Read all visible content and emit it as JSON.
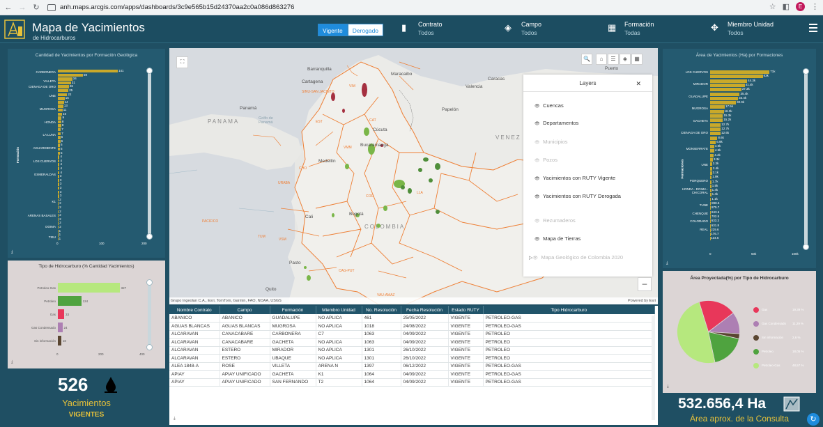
{
  "browser": {
    "url": "anh.maps.arcgis.com/apps/dashboards/3c9e565b15d24370aa2c0a086d863276",
    "profile": "E"
  },
  "header": {
    "title": "Mapa de Yacimientos",
    "subtitle": "de Hidrocarburos",
    "toggle": [
      "Vigente",
      "Derogado"
    ],
    "filters": [
      {
        "label": "Contrato",
        "value": "Todos",
        "icon": "document-icon"
      },
      {
        "label": "Campo",
        "value": "Todos",
        "icon": "layers-icon"
      },
      {
        "label": "Formación",
        "value": "Todas",
        "icon": "grid-icon"
      },
      {
        "label": "Miembro Unidad",
        "value": "Todos",
        "icon": "move-icon"
      }
    ]
  },
  "left_chart": {
    "title": "Cantidad de Yacimientos por Formación Geológica",
    "ylabel": "Formación",
    "xticks": [
      "0",
      "100",
      "200"
    ],
    "labels": [
      "CARBONERA",
      "VILLETA",
      "CIENAGA DE ORO",
      "UNE",
      "MUGROSA",
      "HONDA",
      "LA LUNA",
      "AGUARDIENTE",
      "LOS CUERVOS",
      "ESMERALDAS",
      "K1",
      "ARENAS BASALES",
      "DOIMA",
      "TIBU"
    ],
    "chart_data": {
      "type": "bar",
      "values": [
        141,
        59,
        34,
        31,
        26,
        25,
        22,
        16,
        14,
        13,
        11,
        10,
        9,
        8,
        8,
        7,
        7,
        6,
        6,
        5,
        5,
        5,
        4,
        4,
        4,
        4,
        4,
        3,
        3,
        3,
        3,
        3,
        3,
        2,
        2,
        2,
        2,
        2,
        2,
        2,
        2,
        1,
        1,
        1
      ],
      "xlim": [
        0,
        200
      ]
    }
  },
  "left_hc_chart": {
    "title": "Tipo de Hidrocarburo (% Cantidad Yacimientos)",
    "xticks": [
      "0",
      "200",
      "400"
    ],
    "chart_data": {
      "type": "bar",
      "categories": [
        "Petroleo-Gas",
        "Petroleo",
        "Gas",
        "Gas Condensado",
        "Sin información"
      ],
      "values": [
        327,
        124,
        33,
        24,
        18
      ],
      "colors": [
        "#b6e87e",
        "#4fa33f",
        "#e8375a",
        "#ad7fb3",
        "#5a4631"
      ]
    }
  },
  "counter_left": {
    "number": "526",
    "label": "Yacimientos",
    "sub": "VIGENTES"
  },
  "map": {
    "labels": {
      "barranquilla": "Barranquilla",
      "cartagena": "Cartagena",
      "maracaibo": "Maracaibo",
      "valencia": "Valencia",
      "caracas": "Caracas",
      "panama": "Panamá",
      "panama_gulf": "Golfo de Panamá",
      "papelon": "Papelón",
      "cucuta": "Cúcuta",
      "bucaramanga": "Bucaramanga",
      "medellin": "Medellín",
      "bogota": "Bogotá",
      "cali": "Cali",
      "pasto": "Pasto",
      "quito": "Quito",
      "colombia": "COLOMBIA",
      "venezuela": "VENEZ",
      "panama_cap": "PANAMA",
      "puerto": "Puerto"
    },
    "basins": [
      "CHO",
      "SINU-SAN JACINTO",
      "VMM",
      "LLA",
      "COR",
      "CAG-PUT",
      "PACIFICO",
      "URABA",
      "VIM",
      "CAT",
      "EST",
      "TUM",
      "VSM",
      "VAU-AMAZ"
    ],
    "attribution": "Grupo Ingeolan C.A., Esri, TomTom, Garmin, FAO, NOAA, USGS",
    "powered": "Powered by Esri"
  },
  "layers_panel": {
    "title": "Layers",
    "items": [
      {
        "label": "Cuencas",
        "visible": true
      },
      {
        "label": "Departamentos",
        "visible": true
      },
      {
        "label": "Municipios",
        "visible": false
      },
      {
        "label": "Pozos",
        "visible": false
      },
      {
        "label": "Yacimientos con RUTY Vigente",
        "visible": true
      },
      {
        "label": "Yacimientos con RUTY Derogada",
        "visible": true
      },
      {
        "label": "Rezumaderos",
        "visible": false
      },
      {
        "label": "Mapa de Tierras",
        "visible": true
      },
      {
        "label": "Mapa Geológico de Colombia 2020",
        "visible": false
      }
    ]
  },
  "table": {
    "headers": [
      "Nombre Contrato",
      "Campo",
      "Formación",
      "Miembro Unidad",
      "No. Resolución",
      "Fecha Resolución",
      "Estado RUTY",
      "Tipo Hidrocarburo"
    ],
    "rows": [
      [
        "ABANICO",
        "ABANICO",
        "GUADALUPE",
        "NO APLICA",
        "461",
        "25/05/2022",
        "VIGENTE",
        "PETROLEO-GAS"
      ],
      [
        "AGUAS BLANCAS",
        "AGUAS BLANCAS",
        "MUGROSA",
        "NO APLICA",
        "1018",
        "24/08/2022",
        "VIGENTE",
        "PETROLEO-GAS"
      ],
      [
        "ALCARAVAN",
        "CANACABARE",
        "CARBONERA",
        "C7",
        "1063",
        "04/09/2022",
        "VIGENTE",
        "PETROLEO"
      ],
      [
        "ALCARAVAN",
        "CANACABARE",
        "GACHETA",
        "NO APLICA",
        "1063",
        "04/09/2022",
        "VIGENTE",
        "PETROLEO"
      ],
      [
        "ALCARAVAN",
        "ESTERO",
        "MIRADOR",
        "NO APLICA",
        "1301",
        "26/10/2022",
        "VIGENTE",
        "PETROLEO"
      ],
      [
        "ALCARAVAN",
        "ESTERO",
        "UBAQUE",
        "NO APLICA",
        "1301",
        "26/10/2022",
        "VIGENTE",
        "PETROLEO"
      ],
      [
        "ALEA 1848-A",
        "ROSE",
        "VILLETA",
        "ARENA N",
        "1397",
        "06/12/2022",
        "VIGENTE",
        "PETROLEO-GAS"
      ],
      [
        "APIAY",
        "APIAY UNIFICADO",
        "GACHETA",
        "K1",
        "1064",
        "04/09/2022",
        "VIGENTE",
        "PETROLEO-GAS"
      ],
      [
        "APIAY",
        "APIAY UNIFICADO",
        "SAN FERNANDO",
        "T2",
        "1064",
        "04/09/2022",
        "VIGENTE",
        "PETROLEO-GAS"
      ]
    ]
  },
  "right_chart": {
    "title": "Área de Yacimientos (Ha) por Formaciones",
    "ylabel": "Formaciones",
    "xticks": [
      "0",
      "50k",
      "100k"
    ],
    "labels": [
      "LOS CUERVOS",
      "MIRADOR",
      "GUADALUPE",
      "MUGROSA",
      "GACHETA",
      "CIENAGA DE ORO",
      "MONSERRATE",
      "UNE",
      "PORQUERO",
      "HONDA - DOIMA - CHICORAL",
      "TUNE",
      "CHENQUE",
      "COLORADO",
      "REAL"
    ],
    "chart_data": {
      "type": "bar",
      "values": [
        71000,
        63000,
        44300,
        41400,
        37300,
        35400,
        33400,
        30900,
        17500,
        16300,
        15300,
        15200,
        12700,
        12700,
        12600,
        8600,
        6900,
        4900,
        4900,
        4400,
        3300,
        2300,
        2400,
        2100,
        1900,
        1700,
        1500,
        1400,
        1400,
        1100,
        898.5,
        875.7,
        843.6,
        702.5,
        633.3,
        631.8,
        229.6,
        176.7,
        134.6
      ],
      "value_labels": [
        "71k",
        "63k",
        "44.3k",
        "41.4k",
        "37.3k",
        "35.4k",
        "33.4k",
        "30.9k",
        "17.5k",
        "16.3k",
        "15.3k",
        "15.2k",
        "12.7k",
        "12.7k",
        "12.6k",
        "8.6k",
        "6.9k",
        "4.9k",
        "4.9k",
        "4.4k",
        "3.3k",
        "2.3k",
        "2.4k",
        "2.1k",
        "1.9k",
        "1.7k",
        "1.5k",
        "1.4k",
        "1.4k",
        "1.1k",
        "898.5",
        "875.7",
        "843.6",
        "702.5",
        "633.3",
        "631.8",
        "229.6",
        "176.7",
        "134.6"
      ],
      "xlim": [
        0,
        100000
      ]
    }
  },
  "right_pie": {
    "title": "Área Proyectada(%) por Tipo de Hidrocarburo",
    "chart_data": {
      "type": "pie",
      "categories": [
        "Gas",
        "Gas Condensado",
        "Sin información",
        "Petroleo",
        "Petroleo-Gas"
      ],
      "values": [
        19.39,
        11.29,
        2.6,
        18.05,
        48.57
      ],
      "labels": [
        "19,39 %",
        "11,29 %",
        "2,6 %",
        "18,05 %",
        "48,57 %"
      ],
      "colors": [
        "#e8375a",
        "#ad7fb3",
        "#5a4631",
        "#4fa33f",
        "#b6e87e"
      ]
    }
  },
  "counter_right": {
    "number": "532.656,4 Ha",
    "label": "Área aprox. de la Consulta"
  }
}
